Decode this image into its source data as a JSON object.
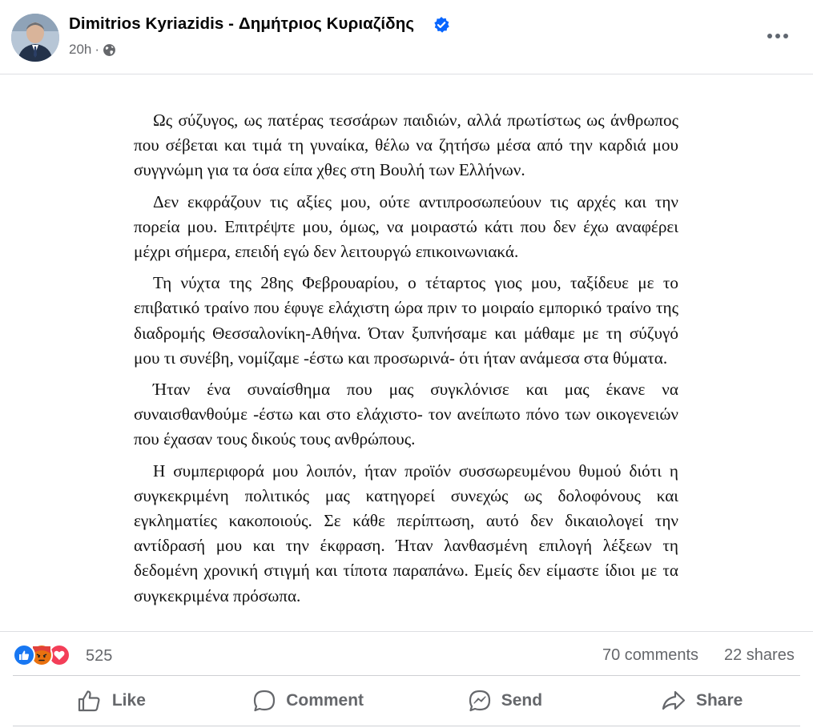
{
  "post": {
    "author": "Dimitrios Kyriazidis - Δημήτριος Κυριαζίδης",
    "time": "20h",
    "separator": "·",
    "privacy_icon": "globe-icon",
    "verified_icon": "verified-badge-icon",
    "more_icon": "more-horizontal-icon"
  },
  "document": {
    "paragraphs": [
      "Ως σύζυγος, ως πατέρας τεσσάρων παιδιών, αλλά πρωτίστως ως άνθρωπος που σέβεται και τιμά τη γυναίκα, θέλω να ζητήσω μέσα από την καρδιά μου συγγνώμη για τα όσα είπα χθες στη Βουλή των Ελλήνων.",
      "Δεν εκφράζουν τις αξίες μου, ούτε αντιπροσωπεύουν τις αρχές και την πορεία μου. Επιτρέψτε μου, όμως, να μοιραστώ κάτι που δεν έχω αναφέρει μέχρι σήμερα, επειδή εγώ δεν λειτουργώ επικοινωνιακά.",
      "Τη νύχτα της 28ης Φεβρουαρίου, ο τέταρτος γιος μου, ταξίδευε με το επιβατικό τραίνο που έφυγε ελάχιστη ώρα πριν το μοιραίο εμπορικό τραίνο της διαδρομής Θεσσαλονίκη-Αθήνα. Όταν ξυπνήσαμε και μάθαμε με τη σύζυγό μου τι συνέβη, νομίζαμε -έστω και προσωρινά- ότι ήταν ανάμεσα στα θύματα.",
      "Ήταν ένα συναίσθημα που μας συγκλόνισε και μας έκανε να συναισθανθούμε -έστω και στο ελάχιστο- τον ανείπωτο πόνο των οικογενειών που έχασαν τους δικούς τους ανθρώπους.",
      "Η συμπεριφορά μου λοιπόν, ήταν προϊόν συσσωρευμένου θυμού διότι η συγκεκριμένη πολιτικός μας κατηγορεί συνεχώς ως δολοφόνους και εγκληματίες κακοποιούς. Σε κάθε περίπτωση, αυτό δεν δικαιολογεί την αντίδρασή μου και την έκφραση. Ήταν λανθασμένη επιλογή λέξεων τη δεδομένη χρονική στιγμή και τίποτα παραπάνω. Εμείς δεν είμαστε ίδιοι με τα συγκεκριμένα πρόσωπα."
    ]
  },
  "reactions": {
    "icons": [
      "like-reaction-icon",
      "angry-reaction-icon",
      "love-reaction-icon"
    ],
    "count": "525",
    "comments": "70 comments",
    "shares": "22 shares"
  },
  "actions": {
    "like": "Like",
    "comment": "Comment",
    "send": "Send",
    "share": "Share"
  },
  "colors": {
    "secondary_text": "#65676b",
    "verified_blue": "#0866ff",
    "like_blue": "#1877f2",
    "love_red": "#f33e58",
    "angry_orange": "#e9710f"
  }
}
